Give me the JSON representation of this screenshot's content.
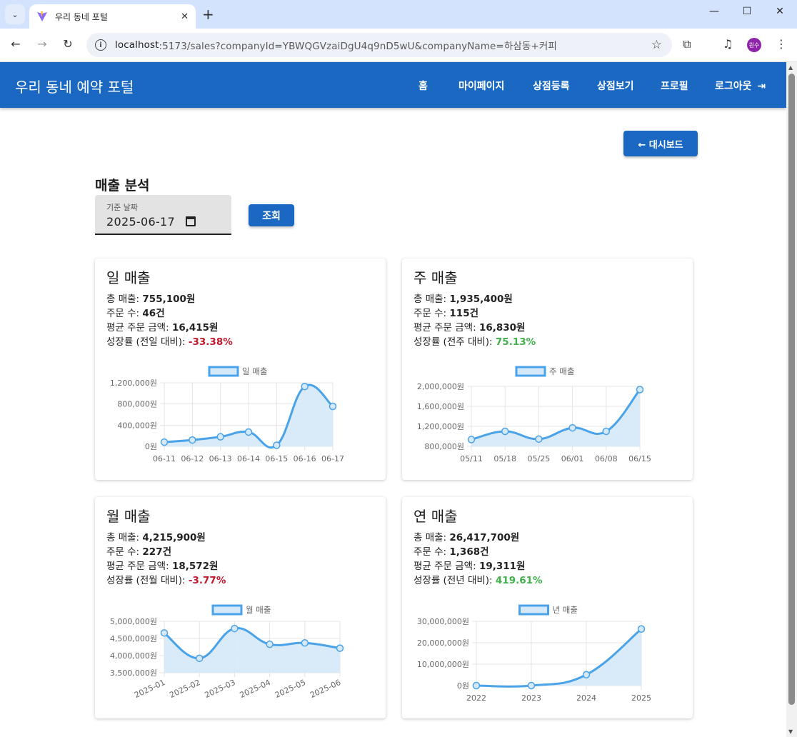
{
  "browser": {
    "tab_title": "우리 동네 포털",
    "url_host": "localhost",
    "url_rest": ":5173/sales?companyId=YBWQGVzaiDgU4q9nD5wU&companyName=하삼동+커피",
    "profile_initials": "원수"
  },
  "app": {
    "brand": "우리 동네 예약 포털",
    "nav": {
      "home": "홈",
      "mypage": "마이페이지",
      "register": "상점등록",
      "stores": "상점보기",
      "profile": "프로필",
      "logout": "로그아웃"
    },
    "dashboard_button": "← 대시보드",
    "section_title": "매출 분석",
    "date_label": "기준 날짜",
    "date_value": "2025-06-17",
    "query_button": "조회"
  },
  "cards": [
    {
      "title": "일 매출",
      "total_label": "총 매출: ",
      "total": "755,100원",
      "orders_label": "주문 수: ",
      "orders": "46건",
      "avg_label": "평균 주문 금액: ",
      "avg": "16,415원",
      "growth_label": "성장률 (전일 대비): ",
      "growth": "-33.38%",
      "growth_dir": "neg"
    },
    {
      "title": "주 매출",
      "total_label": "총 매출: ",
      "total": "1,935,400원",
      "orders_label": "주문 수: ",
      "orders": "115건",
      "avg_label": "평균 주문 금액: ",
      "avg": "16,830원",
      "growth_label": "성장률 (전주 대비): ",
      "growth": "75.13%",
      "growth_dir": "pos"
    },
    {
      "title": "월 매출",
      "total_label": "총 매출: ",
      "total": "4,215,900원",
      "orders_label": "주문 수: ",
      "orders": "227건",
      "avg_label": "평균 주문 금액: ",
      "avg": "18,572원",
      "growth_label": "성장률 (전월 대비): ",
      "growth": "-3.77%",
      "growth_dir": "neg"
    },
    {
      "title": "연 매출",
      "total_label": "총 매출: ",
      "total": "26,417,700원",
      "orders_label": "주문 수: ",
      "orders": "1,368건",
      "avg_label": "평균 주문 금액: ",
      "avg": "19,311원",
      "growth_label": "성장률 (전년 대비): ",
      "growth": "419.61%",
      "growth_dir": "pos"
    }
  ],
  "colors": {
    "primary": "#1a68c2",
    "line": "#4aa3e8",
    "fill": "#d5e9f8",
    "negative": "#c4172b",
    "positive": "#3fb04a"
  },
  "chart_data": [
    {
      "type": "area",
      "legend": "일 매출",
      "x": [
        "06-11",
        "06-12",
        "06-13",
        "06-14",
        "06-15",
        "06-16",
        "06-17"
      ],
      "values": [
        80000,
        120000,
        180000,
        270000,
        20000,
        1130000,
        755100
      ],
      "ylim": [
        0,
        1200000
      ],
      "yticks": [
        "1,200,000원",
        "800,000원",
        "400,000원",
        "0원"
      ],
      "ytick_values": [
        1200000,
        800000,
        400000,
        0
      ],
      "x_rotated": false
    },
    {
      "type": "area",
      "legend": "주 매출",
      "x": [
        "05/11",
        "05/18",
        "05/25",
        "06/01",
        "06/08",
        "06/15"
      ],
      "values": [
        935000,
        1100000,
        945000,
        1170000,
        1100000,
        1935400
      ],
      "ylim": [
        800000,
        2000000
      ],
      "yticks": [
        "2,000,000원",
        "1,600,000원",
        "1,200,000원",
        "800,000원"
      ],
      "ytick_values": [
        2000000,
        1600000,
        1200000,
        800000
      ],
      "x_rotated": false
    },
    {
      "type": "area",
      "legend": "월 매출",
      "x": [
        "2025-01",
        "2025-02",
        "2025-03",
        "2025-04",
        "2025-05",
        "2025-06"
      ],
      "values": [
        4660000,
        3920000,
        4790000,
        4330000,
        4370000,
        4215900
      ],
      "ylim": [
        3500000,
        5000000
      ],
      "yticks": [
        "5,000,000원",
        "4,500,000원",
        "4,000,000원",
        "3,500,000원"
      ],
      "ytick_values": [
        5000000,
        4500000,
        4000000,
        3500000
      ],
      "x_rotated": true
    },
    {
      "type": "area",
      "legend": "년 매출",
      "x": [
        "2022",
        "2023",
        "2024",
        "2025"
      ],
      "values": [
        0,
        0,
        5080000,
        26417700
      ],
      "ylim": [
        0,
        30000000
      ],
      "yticks": [
        "30,000,000원",
        "20,000,000원",
        "10,000,000원",
        "0원"
      ],
      "ytick_values": [
        30000000,
        20000000,
        10000000,
        0
      ],
      "x_rotated": false
    }
  ]
}
